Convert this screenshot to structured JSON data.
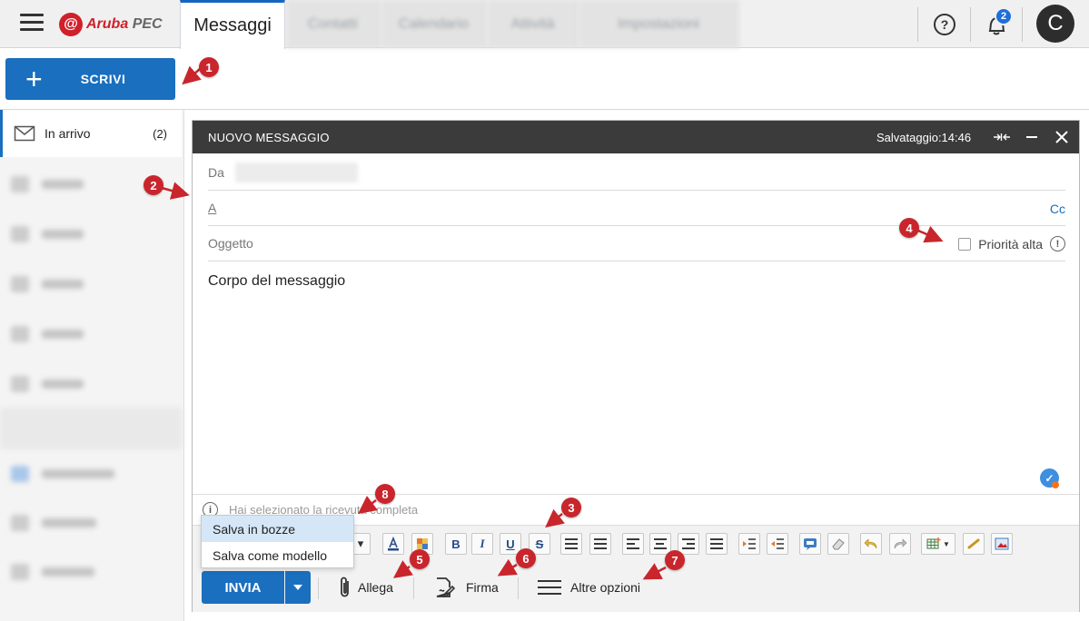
{
  "header": {
    "logo_mark": "@",
    "logo_brand": "Aruba",
    "logo_suffix": "PEC",
    "active_tab": "Messaggi",
    "blurred_tabs": [
      "Contatti",
      "Calendario",
      "Attività",
      "Impostazioni"
    ],
    "help_label": "?",
    "notifications_count": "2",
    "avatar_initial": "C"
  },
  "compose_button": {
    "plus": "+",
    "label": "SCRIVI"
  },
  "sidebar": {
    "items": [
      {
        "label": "In arrivo",
        "count": "(2)",
        "icon": "envelope-icon"
      }
    ]
  },
  "compose": {
    "title": "NUOVO MESSAGGIO",
    "saved_status": "Salvataggio:14:46",
    "from_label": "Da",
    "to_label": "A",
    "cc_label": "Cc",
    "subject_label": "Oggetto",
    "priority_label": "Priorità alta",
    "info_glyph": "!",
    "body_placeholder": "Corpo del messaggio",
    "receipt_glyph": "i",
    "receipt_note": "Hai selezionato la ricevuta completa",
    "send_label": "INVIA",
    "attach_label": "Allega",
    "signature_label": "Firma",
    "more_label": "Altre opzioni",
    "send_menu": [
      "Salva in bozze",
      "Salva come modello"
    ]
  },
  "toolbar": {
    "bold": "B",
    "italic": "I",
    "underline": "U",
    "strike": "S"
  },
  "callouts": [
    "1",
    "2",
    "3",
    "4",
    "5",
    "6",
    "7",
    "8"
  ],
  "colors": {
    "accent": "#1a6fbf",
    "callout": "#c8262c",
    "header_bar": "#3b3b3b",
    "brand": "#d0202a"
  }
}
